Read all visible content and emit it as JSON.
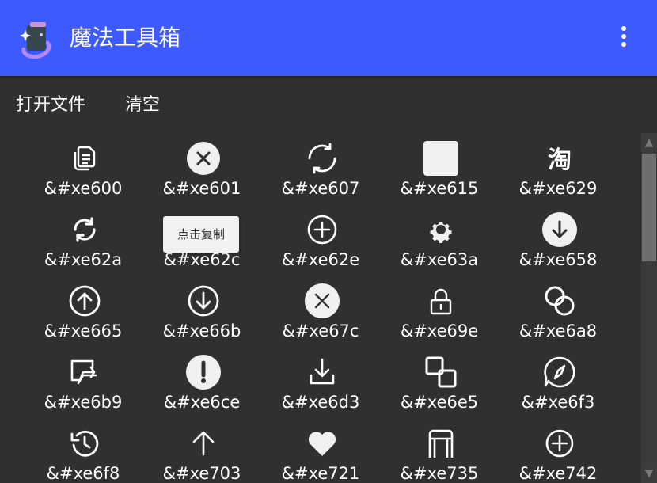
{
  "app": {
    "title": "魔法工具箱"
  },
  "toolbar": {
    "open_file": "打开文件",
    "clear": "清空"
  },
  "tooltip": {
    "text": "点击复制"
  },
  "scroll": {
    "up_arrow": "▲",
    "down_arrow": "▼"
  },
  "icons": [
    {
      "code": "&#xe600",
      "icon": "copy-files-icon"
    },
    {
      "code": "&#xe601",
      "icon": "close-circle-filled-icon"
    },
    {
      "code": "&#xe607",
      "icon": "refresh-icon"
    },
    {
      "code": "&#xe615",
      "icon": "square-filled-icon"
    },
    {
      "code": "&#xe629",
      "icon": "taobao-icon"
    },
    {
      "code": "&#xe62a",
      "icon": "sync-icon"
    },
    {
      "code": "&#xe62c",
      "icon": "unknown-icon"
    },
    {
      "code": "&#xe62e",
      "icon": "add-circle-icon"
    },
    {
      "code": "&#xe63a",
      "icon": "settings-gear-icon"
    },
    {
      "code": "&#xe658",
      "icon": "download-circle-filled-icon"
    },
    {
      "code": "&#xe665",
      "icon": "arrow-up-circle-icon"
    },
    {
      "code": "&#xe66b",
      "icon": "arrow-down-circle-icon"
    },
    {
      "code": "&#xe67c",
      "icon": "close-circle-thin-icon"
    },
    {
      "code": "&#xe69e",
      "icon": "lock-icon"
    },
    {
      "code": "&#xe6a8",
      "icon": "overlap-circles-icon"
    },
    {
      "code": "&#xe6b9",
      "icon": "share-icon"
    },
    {
      "code": "&#xe6ce",
      "icon": "warning-circle-icon"
    },
    {
      "code": "&#xe6d3",
      "icon": "download-tray-icon"
    },
    {
      "code": "&#xe6e5",
      "icon": "overlap-squares-icon"
    },
    {
      "code": "&#xe6f3",
      "icon": "compass-chat-icon"
    },
    {
      "code": "&#xe6f8",
      "icon": "history-icon"
    },
    {
      "code": "&#xe703",
      "icon": "arrow-up-icon"
    },
    {
      "code": "&#xe721",
      "icon": "heart-icon"
    },
    {
      "code": "&#xe735",
      "icon": "box-icon"
    },
    {
      "code": "&#xe742",
      "icon": "add-circle-outline-icon"
    }
  ]
}
